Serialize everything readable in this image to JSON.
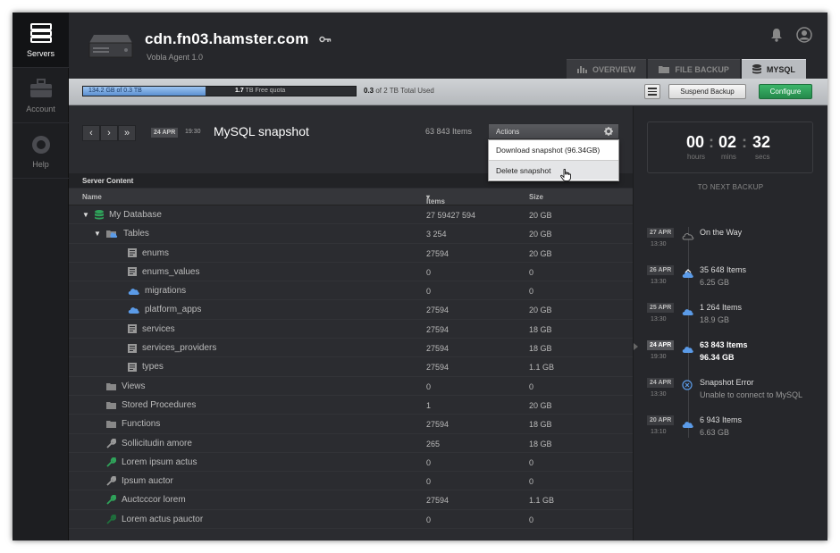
{
  "nav": {
    "items": [
      {
        "label": "Servers",
        "icon": "server-icon",
        "active": true
      },
      {
        "label": "Account",
        "icon": "briefcase-icon",
        "active": false
      },
      {
        "label": "Help",
        "icon": "lifebuoy-icon",
        "active": false
      }
    ]
  },
  "header": {
    "title": "cdn.fn03.hamster.com",
    "subtitle": "Vobla Agent 1.0"
  },
  "tabs": [
    {
      "label": "OVERVIEW",
      "icon": "bar-chart-icon",
      "active": false
    },
    {
      "label": "FILE BACKUP",
      "icon": "folder-icon",
      "active": false
    },
    {
      "label": "MYSQL",
      "icon": "database-icon",
      "active": true
    }
  ],
  "toolbar": {
    "quota_used": "134.2 GB of 0.3 TB",
    "quota_used_fraction": 0.45,
    "quota_free_value": "1.7",
    "quota_free_text": " TB Free quota",
    "total_used_value": "0.3",
    "total_used_text": " of 2 TB Total Used",
    "suspend_label": "Suspend Backup",
    "configure_label": "Configure"
  },
  "snapshot": {
    "date": "24 APR",
    "time": "19:30",
    "title": "MySQL snapshot",
    "items": "63 843 Items",
    "actions_label": "Actions",
    "menu": [
      "Download snapshot (96.34GB)",
      "Delete snapshot"
    ]
  },
  "content": {
    "section_title": "Server Content",
    "columns": {
      "name": "Name",
      "items": "Items",
      "size": "Size"
    },
    "rows": [
      {
        "name": "My Database",
        "items": "27 59427 594",
        "size": "20 GB",
        "level": 0,
        "icon": "database-icon",
        "expand": "▼"
      },
      {
        "name": "Tables",
        "items": "3 254",
        "size": "20 GB",
        "level": 1,
        "icon": "tables-folder-icon",
        "expand": "▼"
      },
      {
        "name": "enums",
        "items": "27594",
        "size": "20 GB",
        "level": 2,
        "icon": "table-icon"
      },
      {
        "name": "enums_values",
        "items": "0",
        "size": "0",
        "level": 2,
        "icon": "table-icon"
      },
      {
        "name": "migrations",
        "items": "0",
        "size": "0",
        "level": 2,
        "icon": "cloud-icon"
      },
      {
        "name": "platform_apps",
        "items": "27594",
        "size": "20 GB",
        "level": 2,
        "icon": "cloud-icon"
      },
      {
        "name": "services",
        "items": "27594",
        "size": "18 GB",
        "level": 2,
        "icon": "table-icon"
      },
      {
        "name": "services_providers",
        "items": "27594",
        "size": "18 GB",
        "level": 2,
        "icon": "table-icon"
      },
      {
        "name": "types",
        "items": "27594",
        "size": "1.1 GB",
        "level": 2,
        "icon": "table-icon"
      },
      {
        "name": "Views",
        "items": "0",
        "size": "0",
        "level": 1,
        "icon": "folder-icon"
      },
      {
        "name": "Stored Procedures",
        "items": "1",
        "size": "20 GB",
        "level": 1,
        "icon": "folder-icon"
      },
      {
        "name": "Functions",
        "items": "27594",
        "size": "18 GB",
        "level": 1,
        "icon": "folder-icon"
      },
      {
        "name": "Sollicitudin amore",
        "items": "265",
        "size": "18 GB",
        "level": 1,
        "icon": "wrench-icon"
      },
      {
        "name": "Lorem ipsum actus",
        "items": "0",
        "size": "0",
        "level": 1,
        "icon": "wrench-green-icon"
      },
      {
        "name": "Ipsum auctor",
        "items": "0",
        "size": "0",
        "level": 1,
        "icon": "wrench-icon"
      },
      {
        "name": "Auctcccor lorem",
        "items": "27594",
        "size": "1.1 GB",
        "level": 1,
        "icon": "wrench-green-icon"
      },
      {
        "name": "Lorem actus pauctor",
        "items": "0",
        "size": "0",
        "level": 1,
        "icon": "wrench-dim-icon"
      }
    ]
  },
  "timer": {
    "hours": "00",
    "mins": "02",
    "secs": "32",
    "hours_label": "hours",
    "mins_label": "mins",
    "secs_label": "secs",
    "caption": "TO NEXT BACKUP"
  },
  "timeline": [
    {
      "date": "27 APR",
      "time": "13:30",
      "line1": "On the Way",
      "line2": "",
      "icon": "cloud-outline-icon",
      "active": false
    },
    {
      "date": "26 APR",
      "time": "13:30",
      "line1": "35 648 Items",
      "line2": "6.25 GB",
      "icon": "cloud-upload-icon",
      "active": false
    },
    {
      "date": "25 APR",
      "time": "13:30",
      "line1": "1 264 Items",
      "line2": "18.9 GB",
      "icon": "cloud-icon",
      "active": false
    },
    {
      "date": "24 APR",
      "time": "19:30",
      "line1": "63 843 Items",
      "line2": "96.34 GB",
      "icon": "cloud-icon",
      "active": true
    },
    {
      "date": "24 APR",
      "time": "13:30",
      "line1": "Snapshot Error",
      "line2": "Unable to connect to MySQL",
      "icon": "error-icon",
      "active": false
    },
    {
      "date": "20 APR",
      "time": "13:10",
      "line1": "6 943 Items",
      "line2": "6.63 GB",
      "icon": "cloud-icon",
      "active": false
    }
  ],
  "colors": {
    "accent_blue": "#5b9be8",
    "green": "#2fa35a",
    "bg_dark": "#2b2c30"
  }
}
